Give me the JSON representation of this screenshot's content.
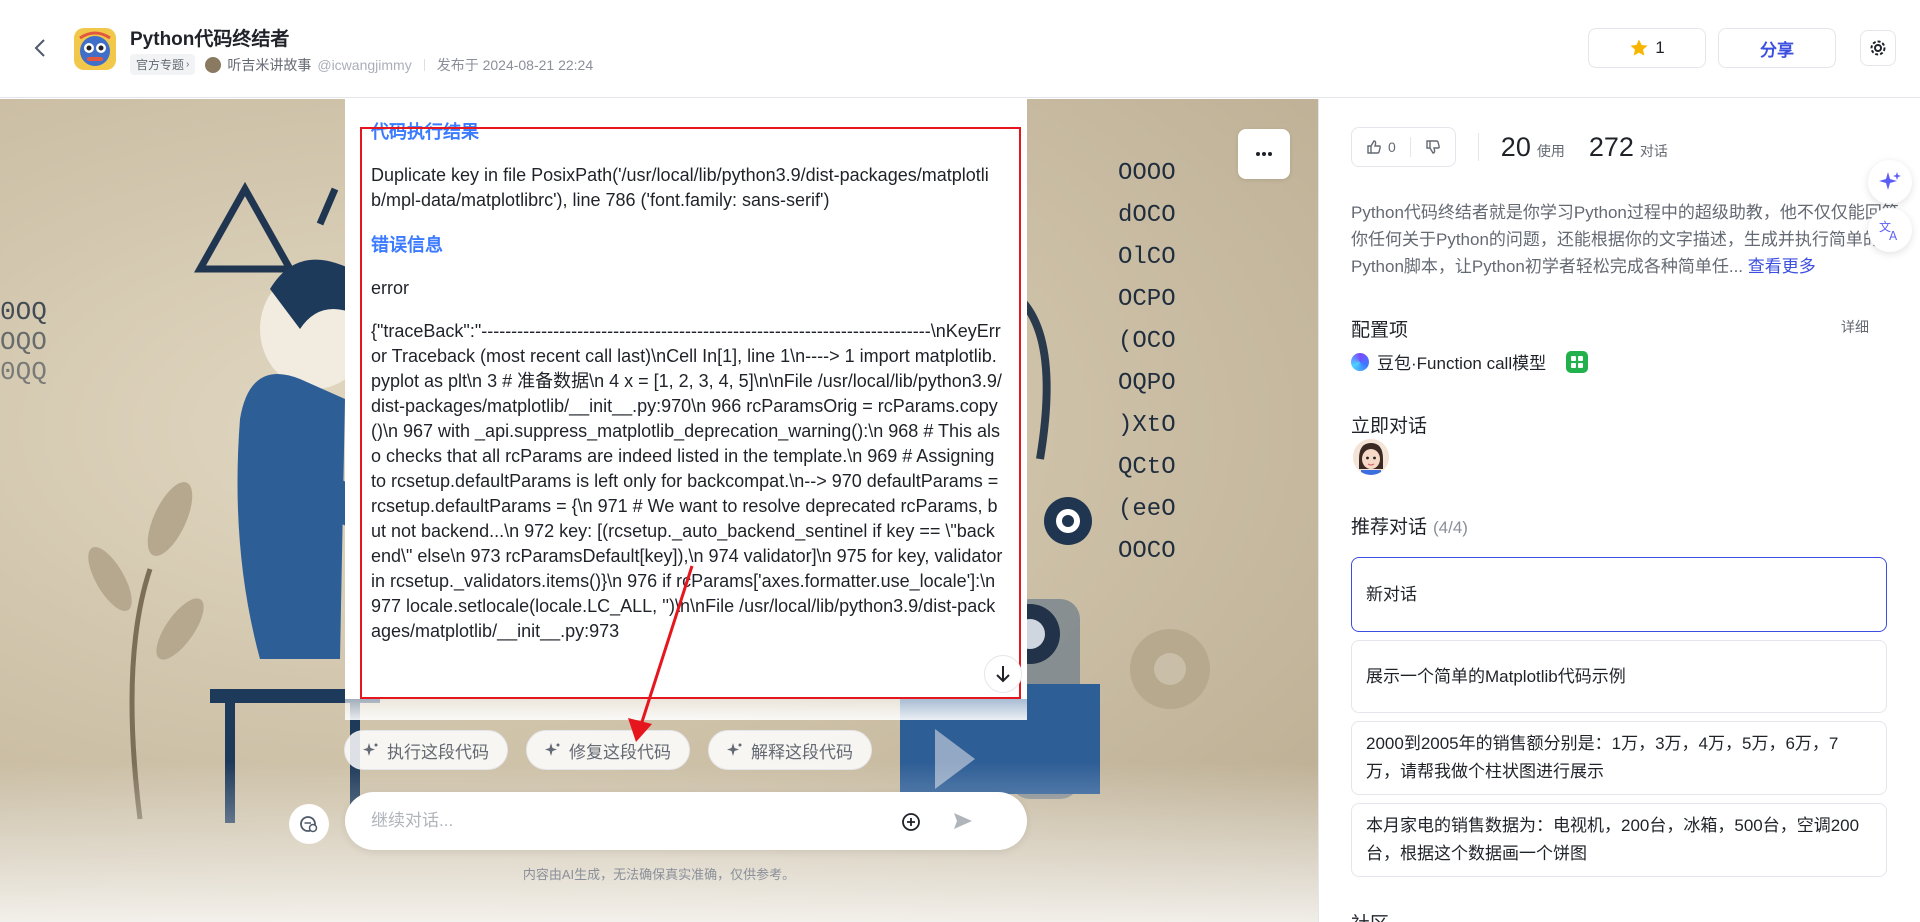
{
  "header": {
    "title": "Python代码终结者",
    "tag": "官方专题",
    "author": "听吉米讲故事",
    "handle": "@icwangjimmy",
    "published": "发布于 2024-08-21 22:24",
    "star_count": "1",
    "share_label": "分享"
  },
  "chat": {
    "partial_line": "(",
    "result_title": "代码执行结果",
    "result_text": "Duplicate key in file PosixPath('/usr/local/lib/python3.9/dist-packages/matplotlib/mpl-data/matplotlibrc'), line 786 ('font.family: sans-serif')",
    "error_title": "错误信息",
    "error_word": "error",
    "traceback": "{\"traceBack\":\"---------------------------------------------------------------------------\\nKeyError Traceback (most recent call last)\\nCell In[1], line 1\\n----> 1 import matplotlib.pyplot as plt\\n 3 # 准备数据\\n 4 x = [1, 2, 3, 4, 5]\\n\\nFile /usr/local/lib/python3.9/dist-packages/matplotlib/__init__.py:970\\n 966 rcParamsOrig = rcParams.copy()\\n 967 with _api.suppress_matplotlib_deprecation_warning():\\n 968 # This also checks that all rcParams are indeed listed in the template.\\n 969 # Assigning to rcsetup.defaultParams is left only for backcompat.\\n--> 970 defaultParams = rcsetup.defaultParams = {\\n 971 # We want to resolve deprecated rcParams, but not backend...\\n 972 key: [(rcsetup._auto_backend_sentinel if key == \\\"backend\\\" else\\n 973 rcParamsDefault[key]),\\n 974 validator]\\n 975 for key, validator in rcsetup._validators.items()}\\n 976 if rcParams['axes.formatter.use_locale']:\\n 977 locale.setlocale(locale.LC_ALL, '')\\n\\nFile /usr/local/lib/python3.9/dist-packages/matplotlib/__init__.py:973"
  },
  "actions": {
    "run": "执行这段代码",
    "fix": "修复这段代码",
    "explain": "解释这段代码"
  },
  "input": {
    "placeholder": "继续对话...",
    "disclaimer": "内容由AI生成，无法确保真实准确，仅供参考。"
  },
  "sidebar": {
    "likes": "0",
    "uses_num": "20",
    "uses_label": "使用",
    "chats_num": "272",
    "chats_label": "对话",
    "description": "Python代码终结者就是你学习Python过程中的超级助教，他不仅仅能回答你任何关于Python的问题，还能根据你的文字描述，生成并执行简单的Python脚本，让Python初学者轻松完成各种简单任...",
    "see_more": "查看更多",
    "config_label": "配置项",
    "detail": "详细",
    "model": "豆包·Function call模型",
    "chat_now": "立即对话",
    "recommend_label": "推荐对话",
    "recommend_count": "(4/4)",
    "recommendations": [
      "新对话",
      "展示一个简单的Matplotlib代码示例",
      "2000到2005年的销售额分别是：1万，3万，4万，5万，6万，7万，请帮我做个柱状图进行展示",
      "本月家电的销售数据为：电视机，200台，冰箱，500台，空调200台，根据这个数据画一个饼图"
    ],
    "bottom_peek": "社区"
  },
  "colors": {
    "accent": "#3c4fe0",
    "highlight": "#e6161e",
    "section_title": "#3c7bff",
    "star": "#f7b500"
  }
}
